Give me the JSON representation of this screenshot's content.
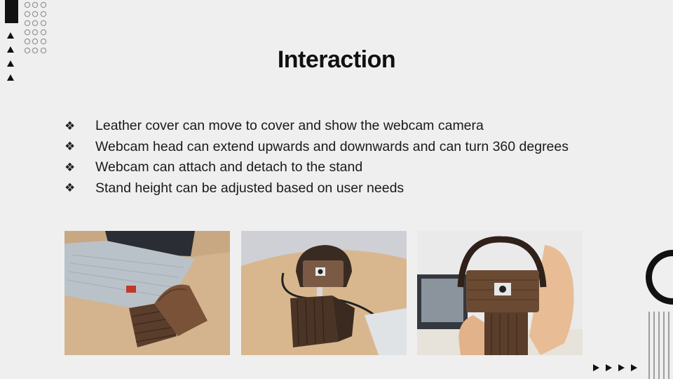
{
  "slide": {
    "title": "Interaction",
    "bullet_symbol": "❖",
    "bullets": [
      "Leather cover can move to cover and show the webcam camera",
      "Webcam head can extend upwards and downwards and can turn 360 degrees",
      "Webcam can attach and detach to the stand",
      "Stand height can be adjusted based on user needs"
    ]
  },
  "photos": [
    {
      "subject": "webcam-with-leather-cover-next-to-laptop"
    },
    {
      "subject": "webcam-on-stand-with-cable"
    },
    {
      "subject": "webcam-held-in-hand"
    }
  ],
  "colors": {
    "background": "#efefef",
    "text": "#111111",
    "wood": "#5a4030"
  }
}
